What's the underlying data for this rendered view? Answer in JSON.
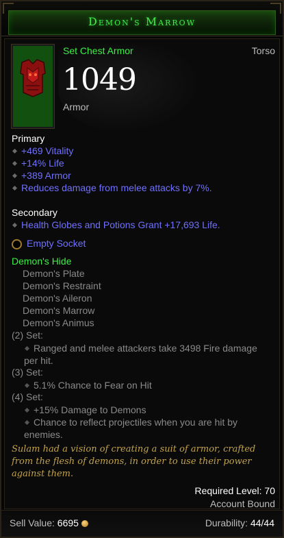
{
  "item": {
    "name": "Demon's Marrow",
    "type": "Set Chest Armor",
    "slot": "Torso",
    "armor_value": "1049",
    "armor_label": "Armor"
  },
  "primary": {
    "heading": "Primary",
    "stats": [
      "+469 Vitality",
      "+14% Life",
      "+389 Armor",
      "Reduces damage from melee attacks by 7%."
    ]
  },
  "secondary": {
    "heading": "Secondary",
    "stats": [
      "Health Globes and Potions Grant +17,693 Life."
    ]
  },
  "socket": {
    "label": "Empty Socket"
  },
  "set": {
    "name": "Demon's Hide",
    "items": [
      "Demon's Plate",
      "Demon's Restraint",
      "Demon's Aileron",
      "Demon's Marrow",
      "Demon's Animus"
    ],
    "bonuses": [
      {
        "label": "(2) Set:",
        "lines": [
          "Ranged and melee attackers take 3498 Fire damage per hit."
        ]
      },
      {
        "label": "(3) Set:",
        "lines": [
          "5.1% Chance to Fear on Hit"
        ]
      },
      {
        "label": "(4) Set:",
        "lines": [
          "+15% Damage to Demons",
          "Chance to reflect projectiles when you are hit by enemies."
        ]
      }
    ]
  },
  "flavor": "Sulam had a vision of creating a suit of armor, crafted from the flesh of demons, in order to use their power against them.",
  "requirements": {
    "required_level": "Required Level: 70",
    "binding": "Account Bound"
  },
  "footer": {
    "sell_label": "Sell Value: ",
    "sell_value": "6695",
    "durability_label": "Durability: ",
    "durability_value": "44/44"
  },
  "colors": {
    "set_green": "#3ef048",
    "magic_blue": "#7070ff",
    "flavor_gold": "#c2a34a"
  },
  "icons": {
    "socket": "empty-socket-icon",
    "gold": "gold-coin-icon",
    "bullet": "diamond-bullet-icon"
  }
}
